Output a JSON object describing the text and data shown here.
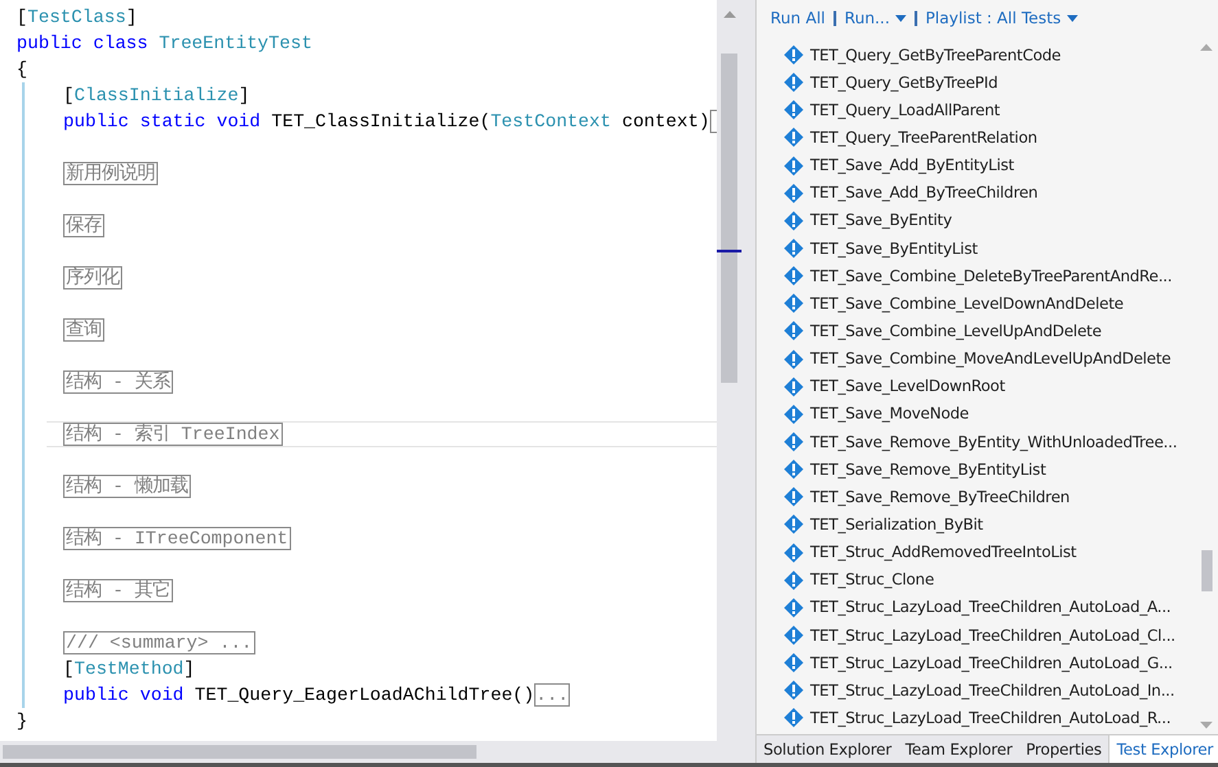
{
  "editor": {
    "header": [
      {
        "tokens": [
          {
            "text": "[",
            "kind": "plain"
          },
          {
            "text": "TestClass",
            "kind": "type"
          },
          {
            "text": "]",
            "kind": "plain"
          }
        ]
      },
      {
        "tokens": [
          {
            "text": "public class ",
            "kind": "keyword"
          },
          {
            "text": "TreeEntityTest",
            "kind": "type"
          }
        ]
      },
      {
        "tokens": [
          {
            "text": "{",
            "kind": "plain"
          }
        ]
      }
    ],
    "body": [
      {
        "kind": "code",
        "tokens": [
          {
            "text": "[",
            "kind": "plain"
          },
          {
            "text": "ClassInitialize",
            "kind": "type"
          },
          {
            "text": "]",
            "kind": "plain"
          }
        ]
      },
      {
        "kind": "code",
        "collapsed": true,
        "tokens": [
          {
            "text": "public static void ",
            "kind": "keyword"
          },
          {
            "text": "TET_ClassInitialize(",
            "kind": "plain"
          },
          {
            "text": "TestContext",
            "kind": "type"
          },
          {
            "text": " context)",
            "kind": "plain"
          }
        ]
      },
      {
        "kind": "blank"
      },
      {
        "kind": "region",
        "label": "新用例说明",
        "current": false
      },
      {
        "kind": "blank"
      },
      {
        "kind": "region",
        "label": "保存",
        "current": false
      },
      {
        "kind": "blank"
      },
      {
        "kind": "region",
        "label": "序列化",
        "current": false
      },
      {
        "kind": "blank"
      },
      {
        "kind": "region",
        "label": "查询",
        "current": false
      },
      {
        "kind": "blank"
      },
      {
        "kind": "region",
        "label": "结构 - 关系",
        "current": false
      },
      {
        "kind": "blank"
      },
      {
        "kind": "region",
        "label": "结构 - 索引 TreeIndex",
        "current": true
      },
      {
        "kind": "blank"
      },
      {
        "kind": "region",
        "label": "结构 - 懒加载",
        "current": false
      },
      {
        "kind": "blank"
      },
      {
        "kind": "region",
        "label": "结构 - ITreeComponent",
        "current": false
      },
      {
        "kind": "blank"
      },
      {
        "kind": "region",
        "label": "结构 - 其它",
        "current": false
      },
      {
        "kind": "blank"
      },
      {
        "kind": "region",
        "label": "/// <summary> ...",
        "current": false
      },
      {
        "kind": "code",
        "tokens": [
          {
            "text": "[",
            "kind": "plain"
          },
          {
            "text": "TestMethod",
            "kind": "type"
          },
          {
            "text": "]",
            "kind": "plain"
          }
        ]
      },
      {
        "kind": "code",
        "collapsed": true,
        "ellipsis": "...",
        "tokens": [
          {
            "text": "public void ",
            "kind": "keyword"
          },
          {
            "text": "TET_Query_EagerLoadAChildTree()",
            "kind": "plain"
          }
        ]
      }
    ],
    "footer": "}"
  },
  "test_explorer": {
    "toolbar": [
      {
        "label": "Run All",
        "dropdown": false
      },
      {
        "label": "Run...",
        "dropdown": true
      },
      {
        "label": "Playlist : All Tests",
        "dropdown": true
      }
    ],
    "tests": [
      "TET_Query_GetByTreeParentCode",
      "TET_Query_GetByTreePId",
      "TET_Query_LoadAllParent",
      "TET_Query_TreeParentRelation",
      "TET_Save_Add_ByEntityList",
      "TET_Save_Add_ByTreeChildren",
      "TET_Save_ByEntity",
      "TET_Save_ByEntityList",
      "TET_Save_Combine_DeleteByTreeParentAndRe...",
      "TET_Save_Combine_LevelDownAndDelete",
      "TET_Save_Combine_LevelUpAndDelete",
      "TET_Save_Combine_MoveAndLevelUpAndDelete",
      "TET_Save_LevelDownRoot",
      "TET_Save_MoveNode",
      "TET_Save_Remove_ByEntity_WithUnloadedTree...",
      "TET_Save_Remove_ByEntityList",
      "TET_Save_Remove_ByTreeChildren",
      "TET_Serialization_ByBit",
      "TET_Struc_AddRemovedTreeIntoList",
      "TET_Struc_Clone",
      "TET_Struc_LazyLoad_TreeChildren_AutoLoad_A...",
      "TET_Struc_LazyLoad_TreeChildren_AutoLoad_Cl...",
      "TET_Struc_LazyLoad_TreeChildren_AutoLoad_G...",
      "TET_Struc_LazyLoad_TreeChildren_AutoLoad_In...",
      "TET_Struc_LazyLoad_TreeChildren_AutoLoad_R..."
    ]
  },
  "bottom_tabs": [
    {
      "label": "Solution Explorer",
      "selected": false
    },
    {
      "label": "Team Explorer",
      "selected": false
    },
    {
      "label": "Properties",
      "selected": false
    },
    {
      "label": "Test Explorer",
      "selected": true
    }
  ]
}
